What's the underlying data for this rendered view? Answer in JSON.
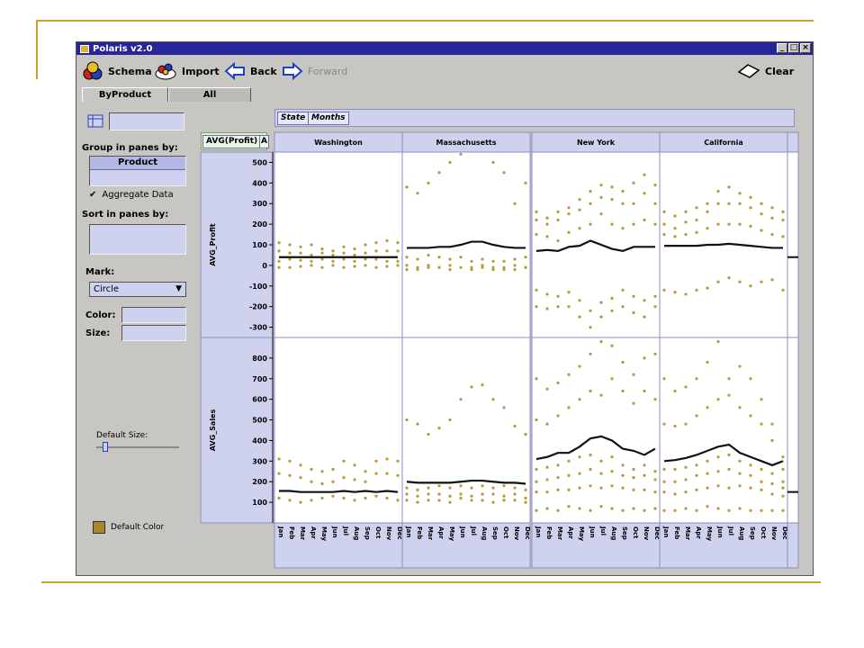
{
  "window": {
    "title": "Polaris v2.0",
    "controls": [
      "_",
      "□",
      "×"
    ]
  },
  "toolbar": {
    "schema_label": "Schema",
    "import_label": "Import",
    "back_label": "Back",
    "forward_label": "Forward",
    "clear_label": "Clear"
  },
  "tabs": [
    {
      "label": "ByProduct"
    },
    {
      "label": "All"
    }
  ],
  "left": {
    "group_label": "Group in panes by:",
    "group_item": "Product",
    "aggregate_label": "Aggregate Data",
    "aggregate_checked": true,
    "sort_label": "Sort in panes by:",
    "mark_label": "Mark:",
    "mark_value": "Circle",
    "color_label": "Color:",
    "size_label": "Size:",
    "default_size_label": "Default Size:",
    "default_size_value": 0.08,
    "default_color_label": "Default Color",
    "default_color": "#a8882a"
  },
  "shelves": {
    "columns": [
      "State",
      "Months"
    ],
    "rows": [
      "AVG(Profit)",
      "A"
    ]
  },
  "colors": {
    "mark": "#b89a3a",
    "trend": "#111111",
    "pane_bg": "#ffffff",
    "header_bg": "#cfd2ee"
  },
  "chart_data": {
    "type": "scatter",
    "columns": [
      "Washington",
      "Massachusetts",
      "New York",
      "California"
    ],
    "months": [
      "Jan",
      "Feb",
      "Mar",
      "Apr",
      "May",
      "Jun",
      "Jul",
      "Aug",
      "Sep",
      "Oct",
      "Nov",
      "Dec"
    ],
    "rows": [
      {
        "ylabel": "AVG_Profit",
        "ylim": [
          -350,
          550
        ],
        "ticks": [
          500,
          400,
          300,
          200,
          100,
          0,
          -100,
          -200,
          -300
        ],
        "trend": [
          [
            40,
            40,
            40,
            40,
            40,
            40,
            40,
            40,
            40,
            40,
            40,
            40
          ],
          [
            85,
            85,
            85,
            90,
            90,
            100,
            115,
            115,
            100,
            90,
            85,
            85
          ],
          [
            70,
            75,
            70,
            90,
            95,
            120,
            100,
            80,
            70,
            90,
            90,
            90
          ],
          [
            95,
            95,
            95,
            95,
            100,
            100,
            105,
            100,
            95,
            90,
            85,
            85
          ]
        ],
        "scatter": [
          [
            [
              110,
              70,
              20,
              -10
            ],
            [
              100,
              60,
              30,
              -10
            ],
            [
              90,
              60,
              25,
              -5
            ],
            [
              100,
              50,
              20,
              0
            ],
            [
              80,
              60,
              30,
              -10
            ],
            [
              70,
              50,
              20,
              0
            ],
            [
              90,
              60,
              30,
              -10
            ],
            [
              80,
              50,
              20,
              -5
            ],
            [
              100,
              60,
              30,
              0
            ],
            [
              110,
              70,
              30,
              -10
            ],
            [
              120,
              70,
              20,
              -5
            ],
            [
              110,
              70,
              20,
              0
            ]
          ],
          [
            [
              380,
              40,
              0,
              -20
            ],
            [
              350,
              30,
              -10,
              -20
            ],
            [
              400,
              50,
              0,
              -10
            ],
            [
              450,
              40,
              -10,
              -10
            ],
            [
              500,
              30,
              0,
              -20
            ],
            [
              540,
              560,
              40,
              -10
            ],
            [
              560,
              20,
              -10,
              -20
            ],
            [
              560,
              30,
              0,
              -10
            ],
            [
              500,
              20,
              -20,
              -10
            ],
            [
              450,
              20,
              -10,
              -20
            ],
            [
              300,
              30,
              0,
              -20
            ],
            [
              400,
              40,
              -10,
              -10
            ]
          ],
          [
            [
              260,
              220,
              150,
              -120,
              -200
            ],
            [
              230,
              200,
              140,
              -140,
              -210
            ],
            [
              260,
              220,
              120,
              -150,
              -200
            ],
            [
              280,
              250,
              160,
              -130,
              -200
            ],
            [
              320,
              270,
              180,
              -170,
              -250
            ],
            [
              360,
              300,
              200,
              -220,
              -300
            ],
            [
              390,
              330,
              250,
              -180,
              -250
            ],
            [
              380,
              320,
              200,
              -160,
              -220
            ],
            [
              360,
              300,
              180,
              -120,
              -200
            ],
            [
              400,
              300,
              200,
              -150,
              -230
            ],
            [
              440,
              350,
              220,
              -170,
              -250
            ],
            [
              390,
              300,
              200,
              -150,
              -200
            ]
          ],
          [
            [
              260,
              200,
              150,
              -120
            ],
            [
              240,
              180,
              140,
              -130
            ],
            [
              260,
              210,
              150,
              -140
            ],
            [
              280,
              220,
              160,
              -120
            ],
            [
              300,
              260,
              180,
              -110
            ],
            [
              360,
              300,
              200,
              -80
            ],
            [
              380,
              300,
              200,
              -60
            ],
            [
              350,
              300,
              200,
              -80
            ],
            [
              330,
              280,
              190,
              -100
            ],
            [
              300,
              250,
              170,
              -80
            ],
            [
              280,
              230,
              150,
              -70
            ],
            [
              260,
              220,
              140,
              -120
            ]
          ]
        ]
      },
      {
        "ylabel": "AVG_Sales",
        "ylim": [
          0,
          900
        ],
        "ticks": [
          800,
          700,
          600,
          500,
          400,
          300,
          200,
          100
        ],
        "trend": [
          [
            155,
            155,
            150,
            150,
            150,
            150,
            155,
            150,
            155,
            150,
            155,
            150
          ],
          [
            200,
            195,
            195,
            195,
            195,
            200,
            205,
            205,
            200,
            195,
            195,
            190
          ],
          [
            310,
            320,
            340,
            340,
            370,
            410,
            420,
            400,
            360,
            350,
            330,
            360
          ],
          [
            300,
            305,
            315,
            330,
            350,
            370,
            380,
            340,
            320,
            300,
            280,
            300
          ]
        ],
        "scatter": [
          [
            [
              310,
              240,
              120
            ],
            [
              300,
              230,
              110
            ],
            [
              280,
              220,
              100
            ],
            [
              260,
              200,
              110
            ],
            [
              250,
              190,
              120
            ],
            [
              260,
              200,
              130
            ],
            [
              300,
              220,
              120
            ],
            [
              280,
              210,
              110
            ],
            [
              250,
              200,
              120
            ],
            [
              300,
              240,
              130
            ],
            [
              310,
              240,
              120
            ],
            [
              300,
              230,
              110
            ]
          ],
          [
            [
              500,
              170,
              140,
              110
            ],
            [
              480,
              160,
              130,
              100
            ],
            [
              430,
              170,
              140,
              110
            ],
            [
              460,
              180,
              140,
              110
            ],
            [
              500,
              170,
              130,
              100
            ],
            [
              600,
              180,
              140,
              120
            ],
            [
              660,
              170,
              130,
              110
            ],
            [
              670,
              180,
              140,
              110
            ],
            [
              600,
              170,
              140,
              100
            ],
            [
              560,
              180,
              130,
              110
            ],
            [
              470,
              170,
              140,
              110
            ],
            [
              430,
              160,
              120,
              100
            ]
          ],
          [
            [
              700,
              500,
              260,
              200,
              150,
              60
            ],
            [
              650,
              480,
              270,
              210,
              150,
              70
            ],
            [
              680,
              520,
              280,
              220,
              160,
              60
            ],
            [
              720,
              560,
              300,
              230,
              160,
              80
            ],
            [
              760,
              600,
              320,
              240,
              170,
              70
            ],
            [
              820,
              640,
              330,
              260,
              180,
              60
            ],
            [
              880,
              620,
              300,
              240,
              170,
              80
            ],
            [
              860,
              700,
              320,
              250,
              180,
              70
            ],
            [
              780,
              640,
              280,
              230,
              170,
              60
            ],
            [
              720,
              580,
              260,
              220,
              160,
              70
            ],
            [
              800,
              640,
              280,
              230,
              160,
              60
            ],
            [
              820,
              600,
              250,
              210,
              150,
              70
            ]
          ],
          [
            [
              700,
              480,
              260,
              200,
              150,
              60
            ],
            [
              640,
              470,
              260,
              200,
              140,
              60
            ],
            [
              660,
              480,
              270,
              210,
              150,
              70
            ],
            [
              700,
              520,
              280,
              230,
              160,
              60
            ],
            [
              780,
              560,
              300,
              240,
              170,
              80
            ],
            [
              880,
              600,
              320,
              250,
              180,
              70
            ],
            [
              700,
              620,
              330,
              260,
              170,
              60
            ],
            [
              760,
              560,
              300,
              240,
              180,
              70
            ],
            [
              700,
              520,
              280,
              230,
              170,
              60
            ],
            [
              600,
              480,
              260,
              200,
              160,
              60
            ],
            [
              480,
              400,
              240,
              190,
              140,
              60
            ],
            [
              320,
              260,
              200,
              170,
              130,
              60
            ]
          ]
        ]
      }
    ],
    "partial_column": {
      "profit_value": 40,
      "sales_value": 150
    }
  }
}
